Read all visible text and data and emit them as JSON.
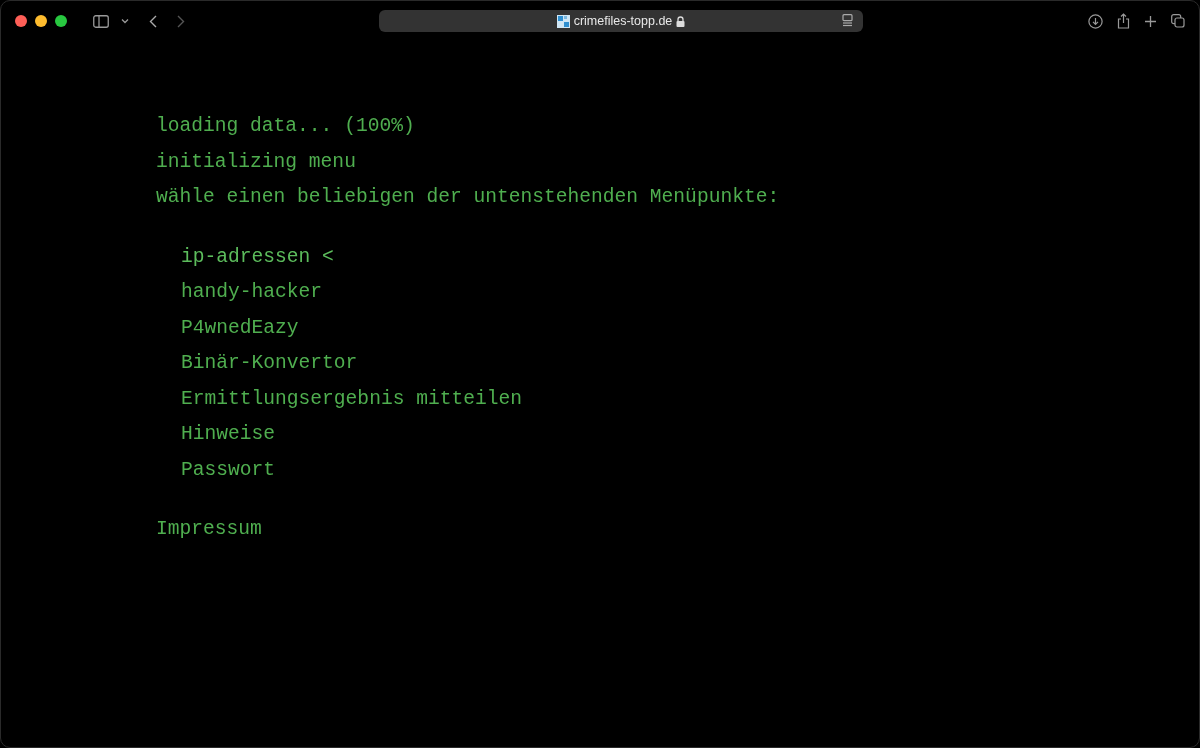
{
  "browser": {
    "url": "crimefiles-topp.de"
  },
  "terminal": {
    "lines": [
      "loading data... (100%)",
      "initializing menu",
      "wähle einen beliebigen der untenstehenden Menüpunkte:"
    ],
    "cursor": "<",
    "menu": [
      {
        "label": "ip-adressen",
        "selected": true
      },
      {
        "label": "handy-hacker",
        "selected": false
      },
      {
        "label": "P4wnedEazy",
        "selected": false
      },
      {
        "label": "Binär-Konvertor",
        "selected": false
      },
      {
        "label": "Ermittlungsergebnis mitteilen",
        "selected": false
      },
      {
        "label": "Hinweise",
        "selected": false
      },
      {
        "label": "Passwort",
        "selected": false
      }
    ],
    "footer_link": "Impressum"
  }
}
